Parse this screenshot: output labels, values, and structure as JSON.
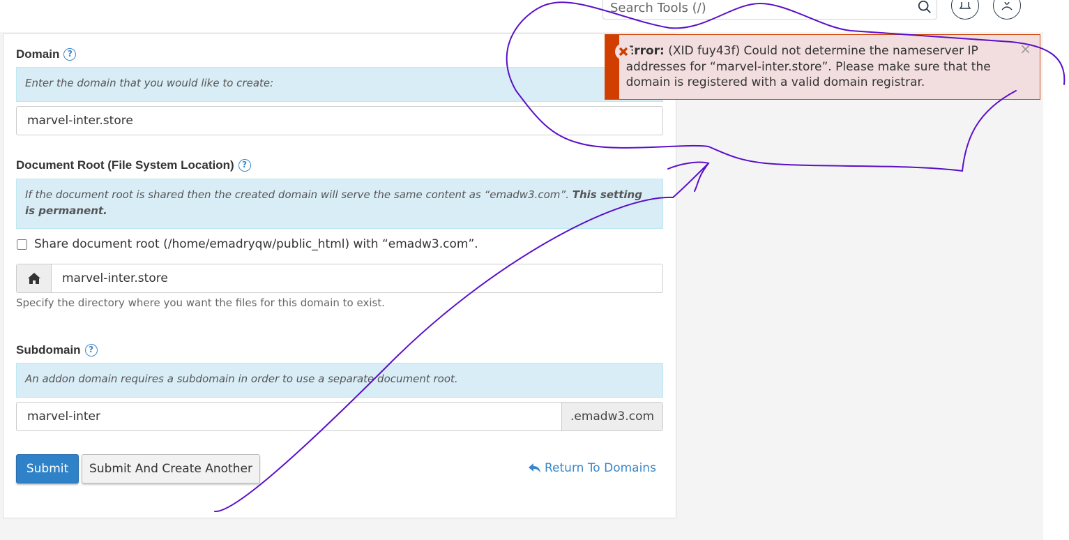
{
  "header": {
    "search_placeholder": "Search Tools (/)"
  },
  "domain": {
    "label": "Domain",
    "info": "Enter the domain that you would like to create:",
    "value": "marvel-inter.store"
  },
  "docroot": {
    "label": "Document Root (File System Location)",
    "info_text": "If the document root is shared then the created domain will serve the same content as “emadw3.com”. ",
    "info_bold": "This setting is permanent.",
    "share_label": "Share document root (/home/emadryqw/public_html) with “emadw3.com”.",
    "share_checked": false,
    "value": "marvel-inter.store",
    "help": "Specify the directory where you want the files for this domain to exist."
  },
  "subdomain": {
    "label": "Subdomain",
    "info": "An addon domain requires a subdomain in order to use a separate document root.",
    "value": "marvel-inter",
    "suffix": ".emadw3.com"
  },
  "actions": {
    "submit": "Submit",
    "submit_another": "Submit And Create Another",
    "return": "Return To Domains"
  },
  "error": {
    "title": "Error:",
    "message": " (XID fuy43f) Could not determine the nameserver IP addresses for “marvel-inter.store”. Please make sure that the domain is registered with a valid domain registrar.",
    "close": "×"
  },
  "colors": {
    "primary": "#2f82c8",
    "info_bg": "#d9edf7",
    "error_bg": "#f2dede",
    "error_accent": "#d03f00",
    "annotation": "#5a0fc8"
  }
}
